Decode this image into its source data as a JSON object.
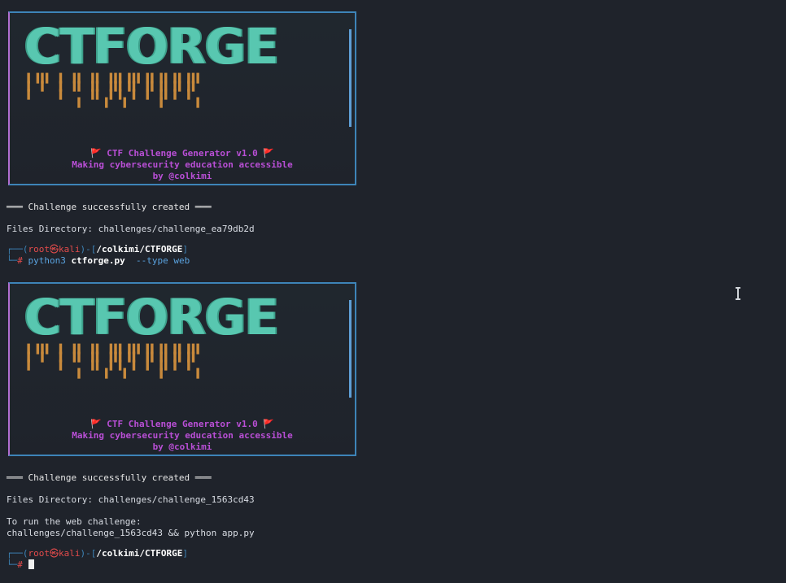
{
  "banner": {
    "logo_text": "CTFORGE",
    "title": "CTF Challenge Generator v1.0",
    "tagline": "Making cybersecurity education accessible",
    "author": "by @colkimi",
    "flag_icon": "flag-icon"
  },
  "run1": {
    "status": "═══ Challenge successfully created ═══",
    "files_dir": "Files Directory: challenges/challenge_ea79db2d"
  },
  "prompt": {
    "user": "root",
    "at": "㉿",
    "host": "kali",
    "path": "/colkimi/CTFORGE",
    "hash": "#",
    "command_prog": "python3",
    "command_script": "ctforge.py",
    "command_args": "--type web"
  },
  "run2": {
    "status": "═══ Challenge successfully created ═══",
    "files_dir": "Files Directory: challenges/challenge_1563cd43",
    "run_hint": "To run the web challenge:",
    "run_cmd": "challenges/challenge_1563cd43 && python app.py"
  },
  "colors": {
    "background": "#1f232b",
    "logo": "#58c7b0",
    "drips": "#c98a3c",
    "banner_text": "#b94fd6",
    "prompt_frame": "#3d84b8",
    "prompt_user": "#e24b4b"
  }
}
